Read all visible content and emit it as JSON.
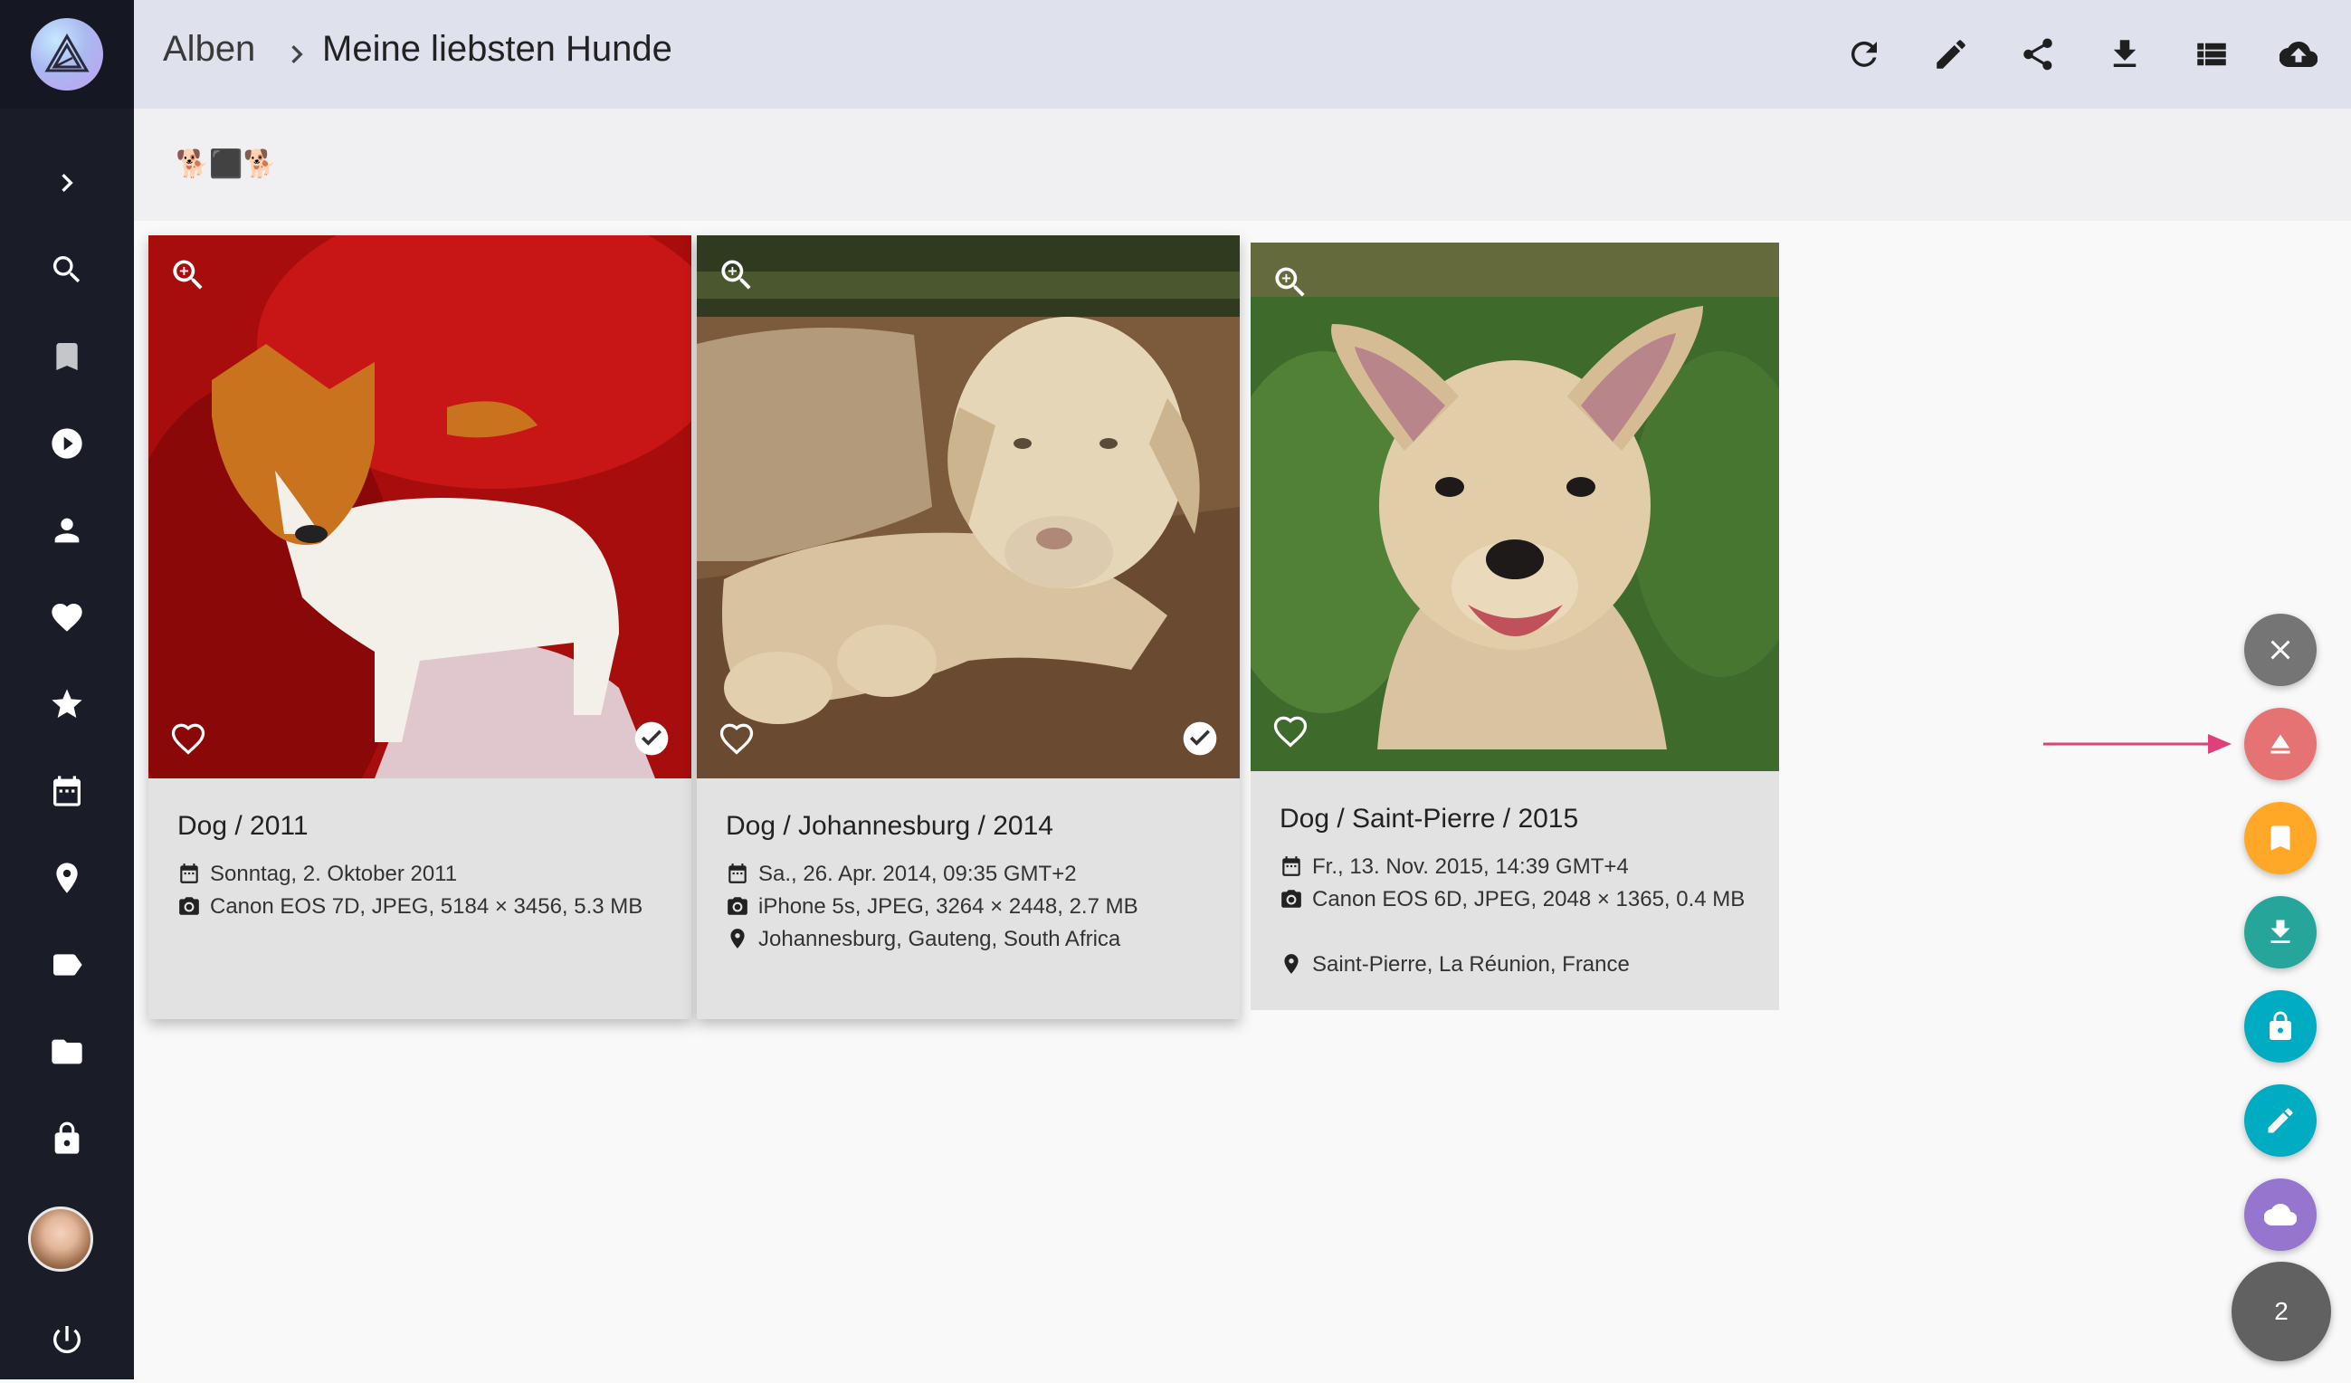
{
  "breadcrumb": {
    "parent": "Alben",
    "current": "Meine liebsten Hunde"
  },
  "album": {
    "description": "🐕‍⬛🐕"
  },
  "colors": {
    "sidebar": "#1a1d28",
    "toolbar": "#dfe1ec",
    "fab_close": "#757575",
    "fab_unshare": "#e57373",
    "fab_bookmark": "#ffa726",
    "fab_download": "#26a69a",
    "fab_private": "#00acc1",
    "fab_edit": "#00acc1",
    "fab_upload": "#9575cd",
    "fab_count": "#616161",
    "arrow": "#e0407a"
  },
  "sidebar_icons": [
    "chevron-right-icon",
    "search-icon",
    "bookmark-icon",
    "play-icon",
    "person-icon",
    "heart-icon",
    "star-icon",
    "calendar-icon",
    "location-icon",
    "label-icon",
    "folder-icon",
    "lock-icon",
    "power-icon"
  ],
  "toolbar_icons": [
    "refresh-icon",
    "edit-icon",
    "share-icon",
    "download-icon",
    "list-view-icon",
    "upload-cloud-icon"
  ],
  "photos": [
    {
      "title": "Dog / 2011",
      "date": "Sonntag, 2. Oktober 2011",
      "camera": "Canon EOS 7D, JPEG, 5184 × 3456, 5.3 MB",
      "location": "",
      "selected": true
    },
    {
      "title": "Dog / Johannesburg / 2014",
      "date": "Sa., 26. Apr. 2014, 09:35 GMT+2",
      "camera": "iPhone 5s, JPEG, 3264 × 2448, 2.7 MB",
      "location": "Johannesburg, Gauteng, South Africa",
      "selected": true
    },
    {
      "title": "Dog / Saint-Pierre / 2015",
      "date": "Fr., 13. Nov. 2015, 14:39 GMT+4",
      "camera": "Canon EOS 6D, JPEG, 2048 × 1365, 0.4 MB",
      "location": "Saint-Pierre, La Réunion, France",
      "selected": false
    }
  ],
  "selection": {
    "count": "2"
  }
}
